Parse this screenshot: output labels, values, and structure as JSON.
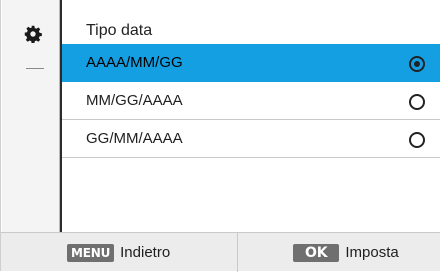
{
  "sidebar": {
    "icon": "gear-icon"
  },
  "header": {
    "title": "Tipo data"
  },
  "options": [
    {
      "label": "AAAA/MM/GG",
      "selected": true
    },
    {
      "label": "MM/GG/AAAA",
      "selected": false
    },
    {
      "label": "GG/MM/AAAA",
      "selected": false
    }
  ],
  "footer": {
    "back_key": "MENU",
    "back_label": "Indietro",
    "confirm_key": "OK",
    "confirm_label": "Imposta"
  },
  "colors": {
    "selection": "#159fe3",
    "key_badge": "#6f6f6f"
  }
}
